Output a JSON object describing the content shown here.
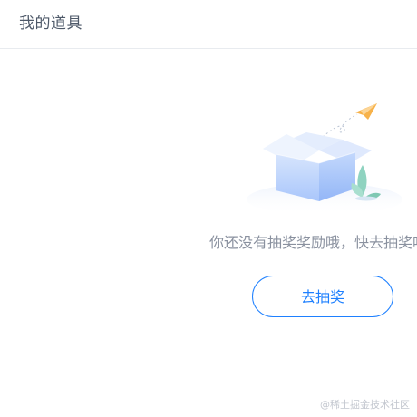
{
  "header": {
    "title": "我的道具"
  },
  "empty_state": {
    "illustration_icon": "empty-box-paper-plane-icon",
    "message": "你还没有抽奖奖励哦，快去抽奖吧",
    "button_label": "去抽奖"
  },
  "watermark": "@稀土掘金技术社区",
  "colors": {
    "accent": "#1e80ff",
    "title_text": "#4e5969",
    "message_text": "#8a919f",
    "divider": "#e8ebef",
    "box_blue": "#bcd3fb",
    "paper_plane": "#f5a623",
    "plant": "#8fd3c0"
  }
}
